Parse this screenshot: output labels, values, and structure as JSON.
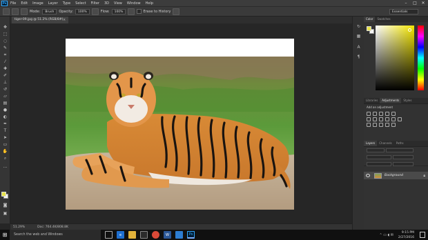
{
  "app": {
    "logo": "Ps"
  },
  "menu": [
    "File",
    "Edit",
    "Image",
    "Layer",
    "Type",
    "Select",
    "Filter",
    "3D",
    "View",
    "Window",
    "Help"
  ],
  "options": {
    "mode_label": "Mode:",
    "mode_value": "Brush",
    "opacity_label": "Opacity:",
    "opacity_value": "100%",
    "flow_label": "Flow:",
    "flow_value": "100%",
    "erase_history": "Erase to History",
    "workspace": "Essentials"
  },
  "document": {
    "tab_label": "tiger-09.jpg @ 51.2% (RGB/8#)",
    "zoom": "51.29%",
    "doc_info": "Doc: 764.4K/808.8K"
  },
  "panels": {
    "color_tabs": [
      "Color",
      "Swatches"
    ],
    "adj_tabs": [
      "Libraries",
      "Adjustments",
      "Styles"
    ],
    "adj_title": "Add an adjustment",
    "layers_tabs": [
      "Layers",
      "Channels",
      "Paths"
    ],
    "layer_name": "Background"
  },
  "colors": {
    "foreground": "#e7e24a",
    "background": "#f4f4f4",
    "accent": "#31a8ff"
  },
  "taskbar": {
    "search_placeholder": "Search the web and Windows",
    "time": "9:15 PM",
    "date": "2/27/2016"
  },
  "icons": {
    "tools": [
      "move-icon",
      "marquee-icon",
      "lasso-icon",
      "quick-select-icon",
      "crop-icon",
      "eyedropper-icon",
      "healing-brush-icon",
      "brush-icon",
      "clone-stamp-icon",
      "history-brush-icon",
      "eraser-icon",
      "gradient-icon",
      "blur-icon",
      "dodge-icon",
      "pen-icon",
      "type-icon",
      "path-select-icon",
      "rectangle-icon",
      "hand-icon",
      "zoom-icon"
    ]
  }
}
